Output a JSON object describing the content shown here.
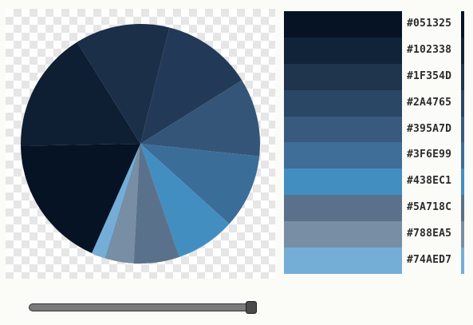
{
  "palette": [
    {
      "hex": "#051325",
      "label": "#051325"
    },
    {
      "hex": "#102338",
      "label": "#102338"
    },
    {
      "hex": "#1F354D",
      "label": "#1F354D"
    },
    {
      "hex": "#2A4765",
      "label": "#2A4765"
    },
    {
      "hex": "#395A7D",
      "label": "#395A7D"
    },
    {
      "hex": "#3F6E99",
      "label": "#3F6E99"
    },
    {
      "hex": "#438EC1",
      "label": "#438EC1"
    },
    {
      "hex": "#5A718C",
      "label": "#5A718C"
    },
    {
      "hex": "#788EA5",
      "label": "#788EA5"
    },
    {
      "hex": "#74AED7",
      "label": "#74AED7"
    }
  ],
  "pie_slices": [
    {
      "color": "#051325",
      "degrees": 89
    },
    {
      "color": "#0f1f33",
      "degrees": 59
    },
    {
      "color": "#1b2f48",
      "degrees": 46
    },
    {
      "color": "#223a58",
      "degrees": 44
    },
    {
      "color": "#345577",
      "degrees": 38
    },
    {
      "color": "#3b6d99",
      "degrees": 36
    },
    {
      "color": "#438EC1",
      "degrees": 29
    },
    {
      "color": "#5A718C",
      "degrees": 22
    },
    {
      "color": "#788EA5",
      "degrees": 14
    },
    {
      "color": "#74AED7",
      "degrees": 7
    }
  ],
  "slider": {
    "value": 0.99
  }
}
